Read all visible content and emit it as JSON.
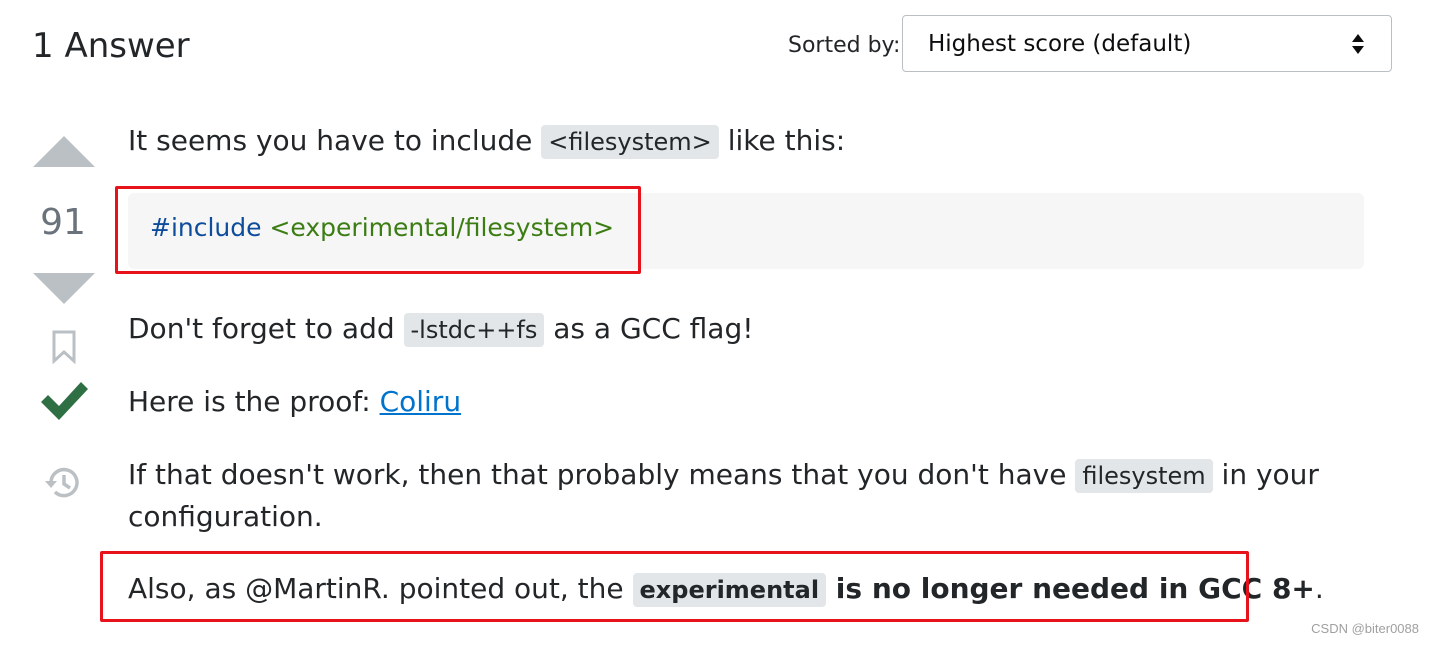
{
  "header": {
    "title": "1 Answer",
    "sort_label": "Sorted by:",
    "sort_value": "Highest score (default)"
  },
  "vote": {
    "count": "91"
  },
  "icons": {
    "upvote": "upvote-arrow-icon",
    "downvote": "downvote-arrow-icon",
    "bookmark": "bookmark-icon",
    "accepted": "checkmark-icon",
    "history": "history-icon"
  },
  "answer": {
    "p1_before": "It seems you have to include ",
    "p1_code": "<filesystem>",
    "p1_after": " like this:",
    "code_keyword": "#include",
    "code_string": "<experimental/filesystem>",
    "p2_before": "Don't forget to add ",
    "p2_code": "-lstdc++fs",
    "p2_after": " as a GCC flag!",
    "p3_before": "Here is the proof: ",
    "p3_link": "Coliru",
    "p4_before": "If that doesn't work, then that probably means that you don't have ",
    "p4_code": "filesystem",
    "p4_after": " in your",
    "p4_line2": "configuration.",
    "p5_before": "Also, as @MartinR. pointed out, the ",
    "p5_code": "experimental",
    "p5_bold": " is no longer needed in GCC 8+",
    "p5_after": "."
  },
  "colors": {
    "highlight_border": "#e8121b",
    "accepted_green": "#2f6f44",
    "link": "#0074cc"
  },
  "watermark": "CSDN @biter0088"
}
